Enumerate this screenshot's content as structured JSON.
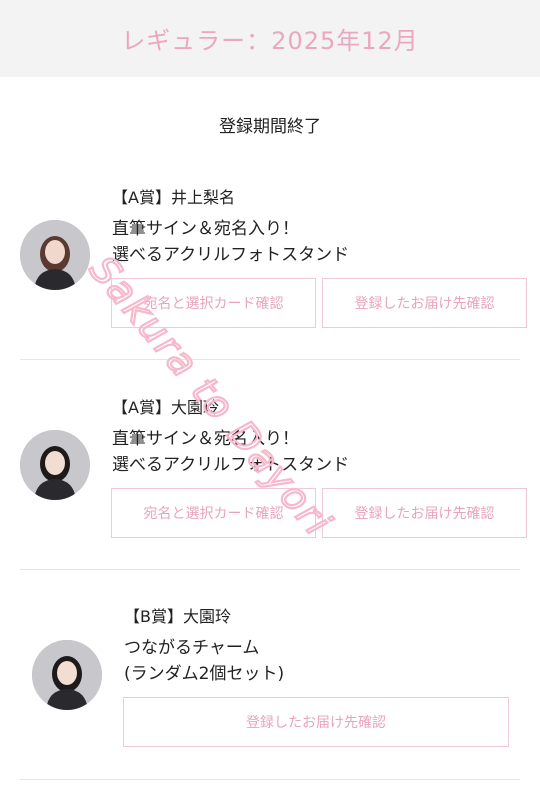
{
  "header": {
    "title": "レギュラー：2025年12月"
  },
  "status": {
    "text": "登録期間終了"
  },
  "items": [
    {
      "prize": "【A賞】井上梨名",
      "desc1": "直筆サイン＆宛名入り！",
      "desc2": "選べるアクリルフォトスタンド",
      "button1": "宛名と選択カード確認",
      "button2": "登録したお届け先確認"
    },
    {
      "prize": "【A賞】大園玲",
      "desc1": "直筆サイン＆宛名入り！",
      "desc2": "選べるアクリルフォトスタンド",
      "button1": "宛名と選択カード確認",
      "button2": "登録したお届け先確認"
    },
    {
      "prize": "【B賞】大園玲",
      "desc1": "つながるチャーム",
      "desc2": "(ランダム2個セット)",
      "button1": "登録したお届け先確認"
    }
  ],
  "watermark": {
    "text": "Sakura to Dayori",
    "color": "#f7b8cc"
  },
  "colors": {
    "header_bg": "#f3f3f3",
    "header_text": "#eba7c0",
    "button_border": "#f0c9d7",
    "button_text": "#e8a4bd"
  }
}
